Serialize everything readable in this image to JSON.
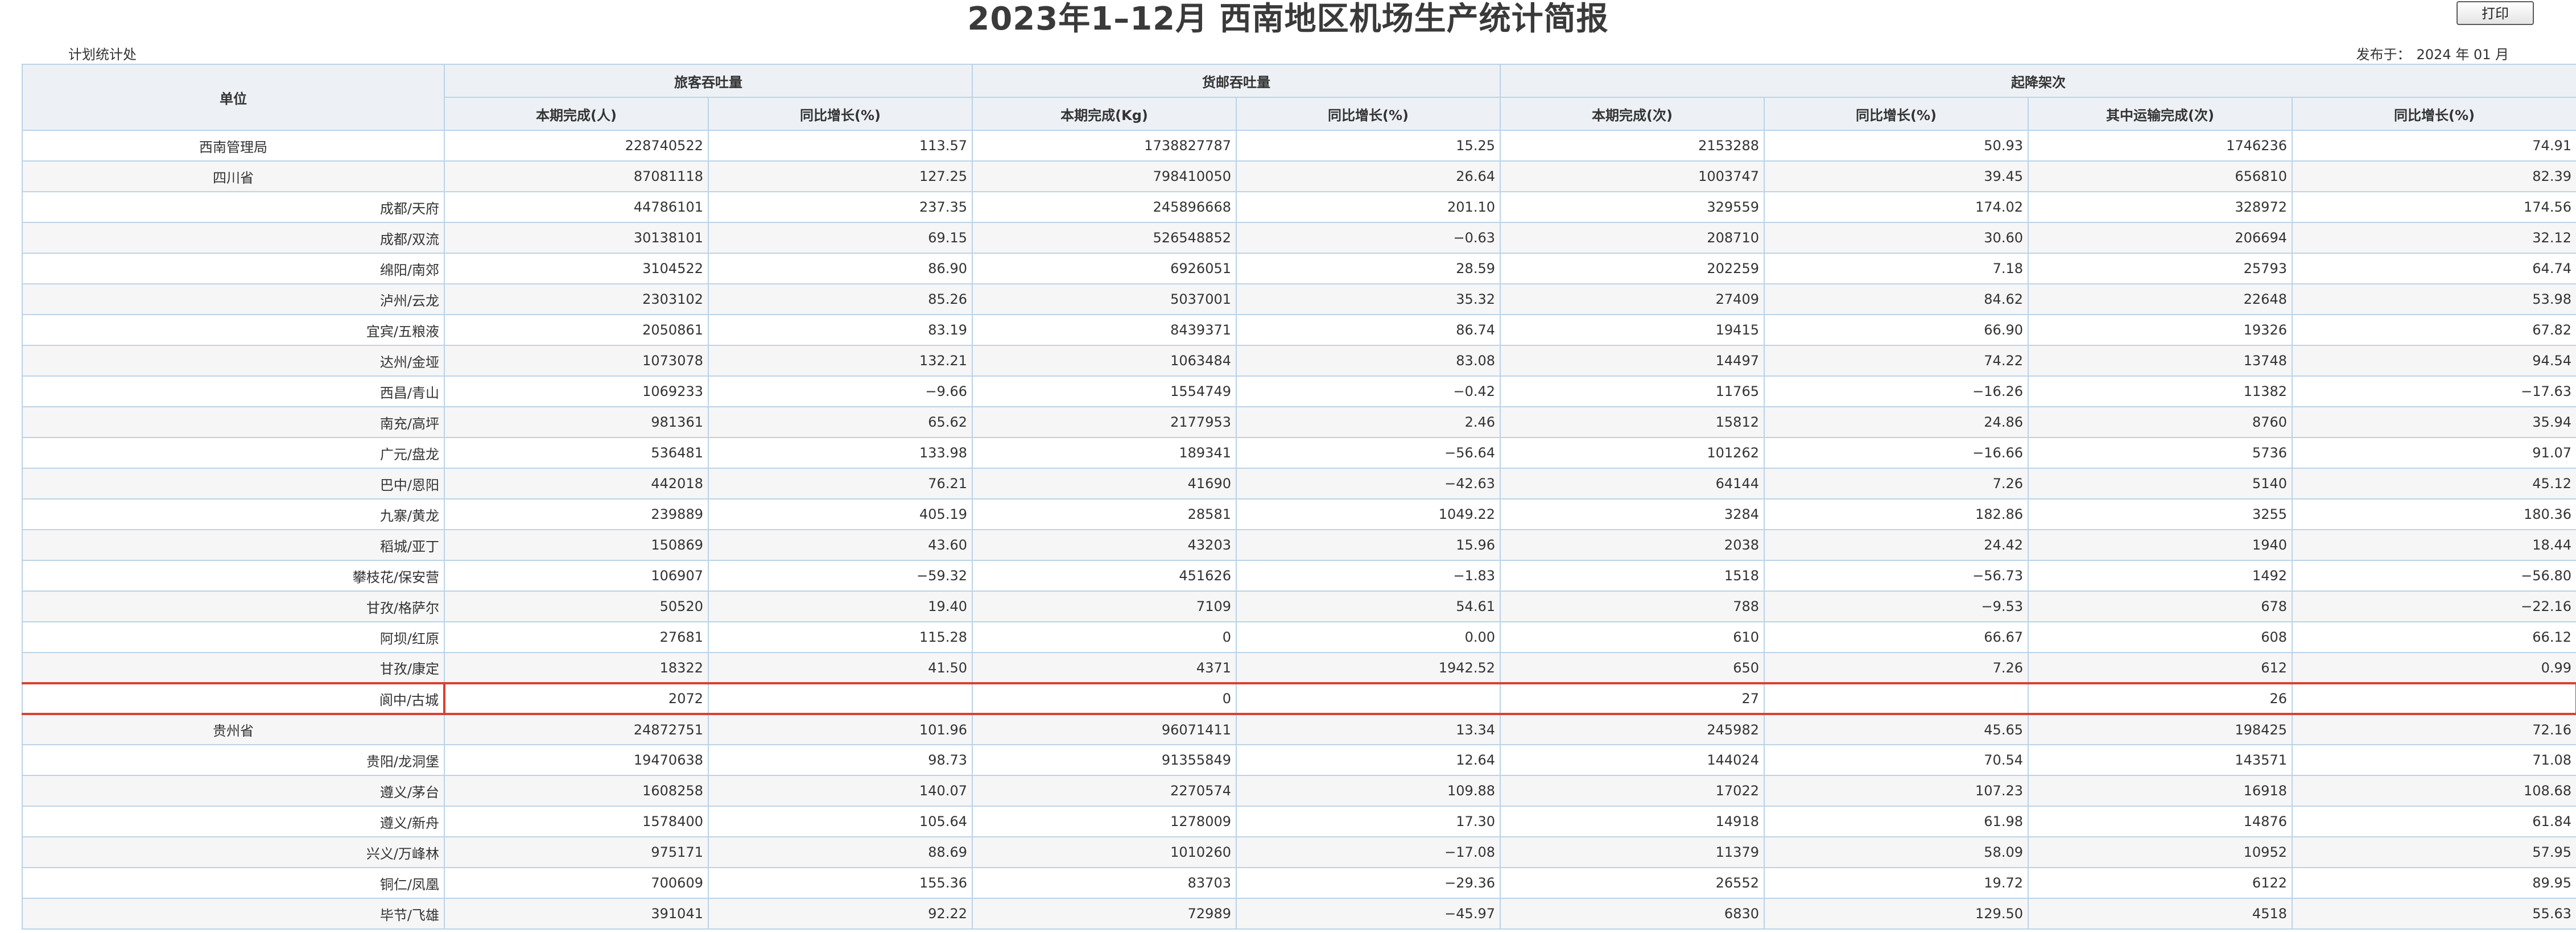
{
  "report": {
    "title": "2023年1–12月 西南地区机场生产统计简报",
    "print_label": "打印",
    "department": "计划统计处",
    "publish_label": "发布于：",
    "publish_date": "2024 年 01 月"
  },
  "table": {
    "unit_header": "单位",
    "groups": {
      "passenger": "旅客吞吐量",
      "cargo": "货邮吞吐量",
      "flights": "起降架次"
    },
    "columns": [
      "本期完成(人)",
      "同比增长(%)",
      "本期完成(Kg)",
      "同比增长(%)",
      "本期完成(次)",
      "同比增长(%)",
      "其中运输完成(次)",
      "同比增长(%)"
    ],
    "rows": [
      {
        "name": "西南管理局",
        "align": "center",
        "values": [
          "228740522",
          "113.57",
          "1738827787",
          "15.25",
          "2153288",
          "50.93",
          "1746236",
          "74.91"
        ]
      },
      {
        "name": "四川省",
        "align": "center",
        "values": [
          "87081118",
          "127.25",
          "798410050",
          "26.64",
          "1003747",
          "39.45",
          "656810",
          "82.39"
        ]
      },
      {
        "name": "成都/天府",
        "align": "right",
        "values": [
          "44786101",
          "237.35",
          "245896668",
          "201.10",
          "329559",
          "174.02",
          "328972",
          "174.56"
        ]
      },
      {
        "name": "成都/双流",
        "align": "right",
        "values": [
          "30138101",
          "69.15",
          "526548852",
          "−0.63",
          "208710",
          "30.60",
          "206694",
          "32.12"
        ]
      },
      {
        "name": "绵阳/南郊",
        "align": "right",
        "values": [
          "3104522",
          "86.90",
          "6926051",
          "28.59",
          "202259",
          "7.18",
          "25793",
          "64.74"
        ]
      },
      {
        "name": "泸州/云龙",
        "align": "right",
        "values": [
          "2303102",
          "85.26",
          "5037001",
          "35.32",
          "27409",
          "84.62",
          "22648",
          "53.98"
        ]
      },
      {
        "name": "宜宾/五粮液",
        "align": "right",
        "values": [
          "2050861",
          "83.19",
          "8439371",
          "86.74",
          "19415",
          "66.90",
          "19326",
          "67.82"
        ]
      },
      {
        "name": "达州/金垭",
        "align": "right",
        "values": [
          "1073078",
          "132.21",
          "1063484",
          "83.08",
          "14497",
          "74.22",
          "13748",
          "94.54"
        ]
      },
      {
        "name": "西昌/青山",
        "align": "right",
        "values": [
          "1069233",
          "−9.66",
          "1554749",
          "−0.42",
          "11765",
          "−16.26",
          "11382",
          "−17.63"
        ]
      },
      {
        "name": "南充/高坪",
        "align": "right",
        "values": [
          "981361",
          "65.62",
          "2177953",
          "2.46",
          "15812",
          "24.86",
          "8760",
          "35.94"
        ]
      },
      {
        "name": "广元/盘龙",
        "align": "right",
        "values": [
          "536481",
          "133.98",
          "189341",
          "−56.64",
          "101262",
          "−16.66",
          "5736",
          "91.07"
        ]
      },
      {
        "name": "巴中/恩阳",
        "align": "right",
        "values": [
          "442018",
          "76.21",
          "41690",
          "−42.63",
          "64144",
          "7.26",
          "5140",
          "45.12"
        ]
      },
      {
        "name": "九寨/黄龙",
        "align": "right",
        "values": [
          "239889",
          "405.19",
          "28581",
          "1049.22",
          "3284",
          "182.86",
          "3255",
          "180.36"
        ]
      },
      {
        "name": "稻城/亚丁",
        "align": "right",
        "values": [
          "150869",
          "43.60",
          "43203",
          "15.96",
          "2038",
          "24.42",
          "1940",
          "18.44"
        ]
      },
      {
        "name": "攀枝花/保安营",
        "align": "right",
        "values": [
          "106907",
          "−59.32",
          "451626",
          "−1.83",
          "1518",
          "−56.73",
          "1492",
          "−56.80"
        ]
      },
      {
        "name": "甘孜/格萨尔",
        "align": "right",
        "values": [
          "50520",
          "19.40",
          "7109",
          "54.61",
          "788",
          "−9.53",
          "678",
          "−22.16"
        ]
      },
      {
        "name": "阿坝/红原",
        "align": "right",
        "values": [
          "27681",
          "115.28",
          "0",
          "0.00",
          "610",
          "66.67",
          "608",
          "66.12"
        ]
      },
      {
        "name": "甘孜/康定",
        "align": "right",
        "values": [
          "18322",
          "41.50",
          "4371",
          "1942.52",
          "650",
          "7.26",
          "612",
          "0.99"
        ]
      },
      {
        "name": "阆中/古城",
        "align": "right",
        "flagged": true,
        "values": [
          "2072",
          "",
          "0",
          "",
          "27",
          "",
          "26",
          ""
        ]
      },
      {
        "name": "贵州省",
        "align": "center",
        "values": [
          "24872751",
          "101.96",
          "96071411",
          "13.34",
          "245982",
          "45.65",
          "198425",
          "72.16"
        ]
      },
      {
        "name": "贵阳/龙洞堡",
        "align": "right",
        "values": [
          "19470638",
          "98.73",
          "91355849",
          "12.64",
          "144024",
          "70.54",
          "143571",
          "71.08"
        ]
      },
      {
        "name": "遵义/茅台",
        "align": "right",
        "values": [
          "1608258",
          "140.07",
          "2270574",
          "109.88",
          "17022",
          "107.23",
          "16918",
          "108.68"
        ]
      },
      {
        "name": "遵义/新舟",
        "align": "right",
        "values": [
          "1578400",
          "105.64",
          "1278009",
          "17.30",
          "14918",
          "61.98",
          "14876",
          "61.84"
        ]
      },
      {
        "name": "兴义/万峰林",
        "align": "right",
        "values": [
          "975171",
          "88.69",
          "1010260",
          "−17.08",
          "11379",
          "58.09",
          "10952",
          "57.95"
        ]
      },
      {
        "name": "铜仁/凤凰",
        "align": "right",
        "values": [
          "700609",
          "155.36",
          "83703",
          "−29.36",
          "26552",
          "19.72",
          "6122",
          "89.95"
        ]
      },
      {
        "name": "毕节/飞雄",
        "align": "right",
        "values": [
          "391041",
          "92.22",
          "72989",
          "−45.97",
          "6830",
          "129.50",
          "4518",
          "55.63"
        ]
      }
    ]
  }
}
